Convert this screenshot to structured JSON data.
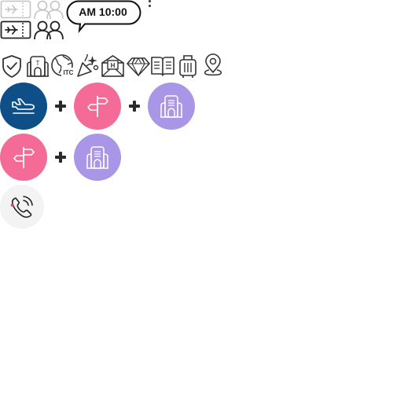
{
  "header": {
    "time_label": "AM 10:00"
  },
  "icons": {
    "top_row": [
      "boarding-pass-faded-icon",
      "travelers-faded-icon"
    ],
    "second_row": [
      "boarding-pass-icon",
      "travelers-icon"
    ],
    "category_row": [
      "shield-check-icon",
      "terminal-building-icon",
      "itc-globe-icon",
      "party-popper-icon",
      "hotel-envelope-icon",
      "diamond-icon",
      "book-icon",
      "luggage-icon",
      "map-pin-icon"
    ],
    "itc_text": "ITC",
    "hotel_letter": "H",
    "terminal_letter": "T"
  },
  "combos": {
    "row1": [
      "flight-icon",
      "signpost-icon",
      "building-icon"
    ],
    "row2": [
      "signpost-icon",
      "building-icon"
    ]
  },
  "colors": {
    "flight_circle": "#0d4f86",
    "signpost_circle": "#f56b97",
    "building_circle": "#a996e6",
    "call_circle": "#f3f3f3",
    "outline": "#333333",
    "faded": "#bdbdbd"
  }
}
